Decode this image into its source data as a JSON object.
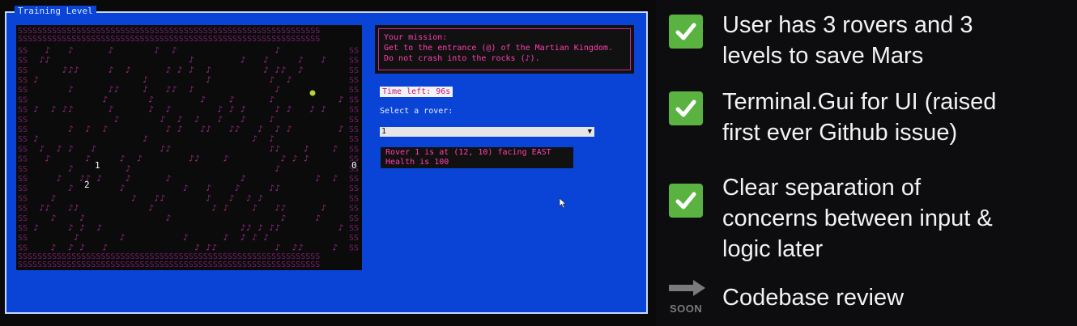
{
  "terminal": {
    "title": "Training Level",
    "map": {
      "rovers": [
        "1",
        "2"
      ],
      "marker": "0"
    },
    "mission": {
      "lines": [
        "Your mission:",
        "Get to the entrance (@) of the Martian Kingdom.",
        "Do not crash into the rocks (♪)."
      ]
    },
    "timer": "Time left: 96s",
    "select_label": "Select a rover:",
    "select_value": "1",
    "status_lines": [
      "Rover 1 is at (12, 10) facing EAST",
      "Health is 100"
    ]
  },
  "checklist": [
    {
      "icon": "check-icon",
      "lines": [
        "User has 3 rovers and 3",
        "levels to save Mars"
      ]
    },
    {
      "icon": "check-icon",
      "lines": [
        "Terminal.Gui for UI (raised",
        "first ever Github issue)"
      ]
    },
    {
      "icon": "check-icon",
      "lines": [
        "Clear separation of",
        "concerns between input &",
        "logic later"
      ]
    },
    {
      "icon": "arrow-right-icon",
      "badge": "SOON",
      "lines": [
        "Codebase review"
      ]
    }
  ],
  "colors": {
    "terminal_bg": "#0a44d6",
    "rock": "#9a2a88",
    "mission_text": "#ff3fb0",
    "check_green": "#5ab341"
  }
}
